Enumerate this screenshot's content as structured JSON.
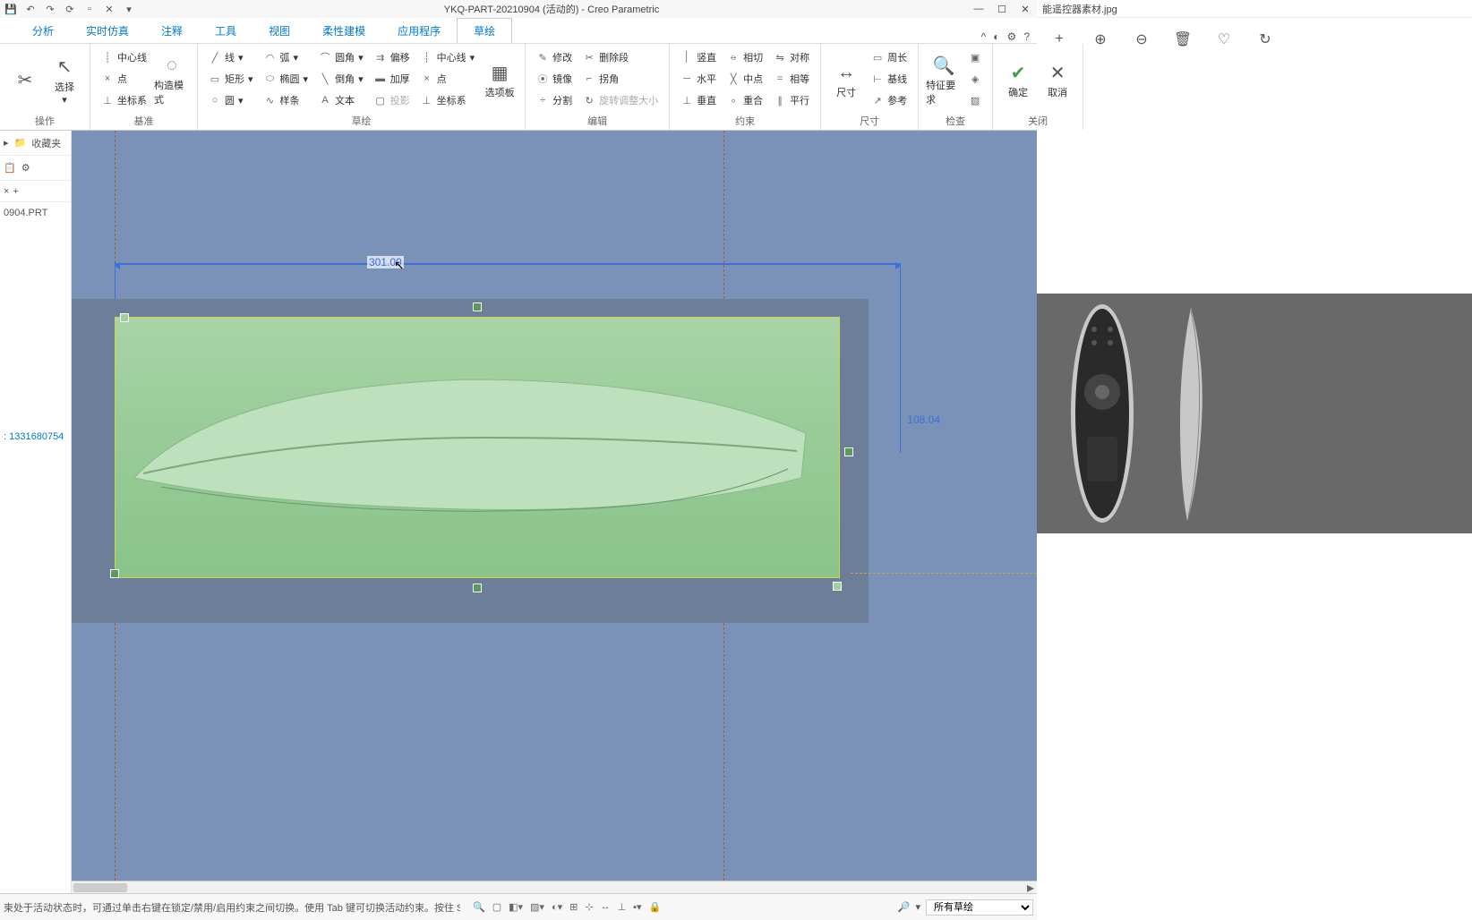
{
  "titlebar": {
    "title": "YKQ-PART-20210904 (活动的) - Creo Parametric"
  },
  "menu": {
    "tabs": [
      "分析",
      "实时仿真",
      "注释",
      "工具",
      "视图",
      "柔性建模",
      "应用程序",
      "草绘"
    ],
    "active_index": 7
  },
  "ribbon": {
    "groups": {
      "operate": {
        "select": "选择",
        "label": "操作"
      },
      "datum": {
        "centerline": "中心线",
        "point": "点",
        "csys": "坐标系",
        "construct_mode": "构造模式",
        "label": "基准"
      },
      "sketch": {
        "line": "线",
        "arc": "弧",
        "rect": "矩形",
        "ellipse": "椭圆",
        "circle": "圆",
        "spline": "样条",
        "fillet": "圆角",
        "chamfer": "倒角",
        "text": "文本",
        "offset": "偏移",
        "thicken": "加厚",
        "project": "投影",
        "centerline2": "中心线",
        "point2": "点",
        "csys2": "坐标系",
        "palette": "选项板",
        "label": "草绘"
      },
      "edit": {
        "modify": "修改",
        "mirror": "镜像",
        "divide": "分割",
        "delete_seg": "删除段",
        "corner": "拐角",
        "rotate_resize": "旋转调整大小",
        "label": "编辑"
      },
      "constrain": {
        "vertical": "竖直",
        "horizontal": "水平",
        "perpendicular": "垂直",
        "tangent": "相切",
        "midpoint": "中点",
        "coincident": "重合",
        "symmetric": "对称",
        "equal": "相等",
        "parallel": "平行",
        "label": "约束"
      },
      "dimension": {
        "dim": "尺寸",
        "perimeter": "周长",
        "baseline": "基线",
        "reference": "参考",
        "label": "尺寸"
      },
      "inspect": {
        "feature_req": "特征要求",
        "label": "检查"
      },
      "close": {
        "ok": "确定",
        "cancel": "取消",
        "label": "关闭"
      }
    }
  },
  "left_panel": {
    "favorites": "收藏夹",
    "file_name": "0904.PRT",
    "phone": "1331680754"
  },
  "canvas": {
    "dim_horizontal": "301.00",
    "dim_vertical": "108.04"
  },
  "status": {
    "message": "束处于活动状态时，可通过单击右键在锁定/禁用/启用约束之间切换。使用 Tab 键可切换活动约束。按住 Shift 键可禁用捕捉",
    "filter_label": "所有草绘"
  },
  "viewer": {
    "title": "能遥控器素材.jpg"
  }
}
